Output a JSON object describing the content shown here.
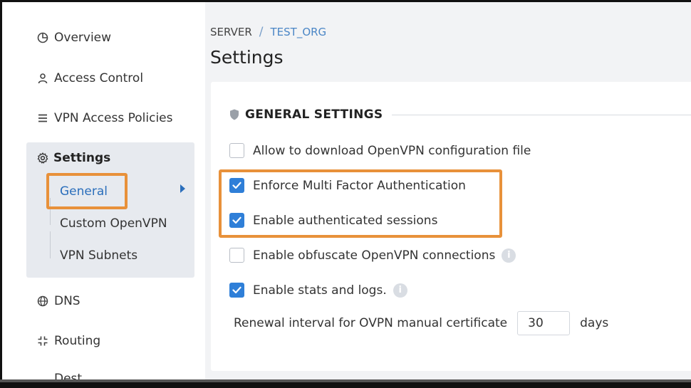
{
  "sidebar": {
    "overview": "Overview",
    "access_control": "Access Control",
    "vpn_access_policies": "VPN Access Policies",
    "settings": "Settings",
    "settings_sub": [
      "General",
      "Custom OpenVPN",
      "VPN Subnets"
    ],
    "dns": "DNS",
    "routing": "Routing",
    "partial": "Dest..."
  },
  "breadcrumb": {
    "server": "SERVER",
    "separator": "/",
    "org": "TEST_ORG"
  },
  "page_title": "Settings",
  "general": {
    "section_title": "GENERAL SETTINGS",
    "options": [
      {
        "label": "Allow to download OpenVPN configuration file",
        "checked": false,
        "info": false
      },
      {
        "label": "Enforce Multi Factor Authentication",
        "checked": true,
        "info": false
      },
      {
        "label": "Enable authenticated sessions",
        "checked": true,
        "info": false
      },
      {
        "label": "Enable obfuscate OpenVPN connections",
        "checked": false,
        "info": true
      },
      {
        "label": "Enable stats and logs.",
        "checked": true,
        "info": true
      }
    ],
    "renewal_label": "Renewal interval for OVPN manual certificate",
    "renewal_value": "30",
    "renewal_unit": "days",
    "info_glyph": "i"
  },
  "colors": {
    "accent": "#2a6ebb",
    "checkbox": "#2f7fd8",
    "highlight": "#e8913a",
    "content_bg": "#f2f3f5",
    "settings_bg": "#e7eaef"
  },
  "icons": {
    "overview": "pie-chart-icon",
    "access_control": "user-icon",
    "vpn_access_policies": "list-icon",
    "settings": "gear-icon",
    "dns": "globe-icon",
    "routing": "routing-icon",
    "section": "shield-icon"
  }
}
